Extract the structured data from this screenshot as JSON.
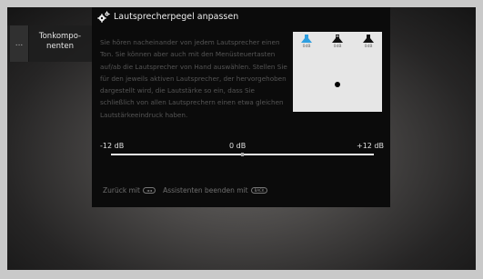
{
  "sidebar": {
    "more_label": "...",
    "item_label": "Tonkompo-\nnenten"
  },
  "dialog": {
    "title": "Lautsprecherpegel anpassen",
    "icon": "gears-icon",
    "description": "Sie hören nacheinander von jedem Lautsprecher einen Ton. Sie können aber auch mit den Menüsteuertasten auf/ab die Lautsprecher von Hand auswählen. Stellen Sie für den jeweils aktiven Lautsprecher, der hervorgehoben dargestellt wird, die Lautstärke so ein, dass Sie schließlich von allen Lautsprechern einen etwa gleichen Lautstärkeeindruck haben.",
    "speakers": [
      {
        "name": "front-left",
        "label": "0dB",
        "color": "#2f9fe0",
        "active": true
      },
      {
        "name": "center",
        "label": "0dB",
        "color": "#111111",
        "active": false
      },
      {
        "name": "front-right",
        "label": "0dB",
        "color": "#111111",
        "active": false
      }
    ],
    "scale": {
      "min_label": "-12 dB",
      "mid_label": "0 dB",
      "max_label": "+12 dB",
      "min": -12,
      "max": 12,
      "value": 0
    },
    "footer": {
      "back_text": "Zurück mit",
      "back_key": "◄◄",
      "exit_text": "Assistenten beenden mit",
      "exit_key": "BACK"
    }
  },
  "colors": {
    "dialog_bg": "#0b0b0b",
    "accent_speaker": "#2f9fe0",
    "bezel": "#c9c9c9"
  }
}
